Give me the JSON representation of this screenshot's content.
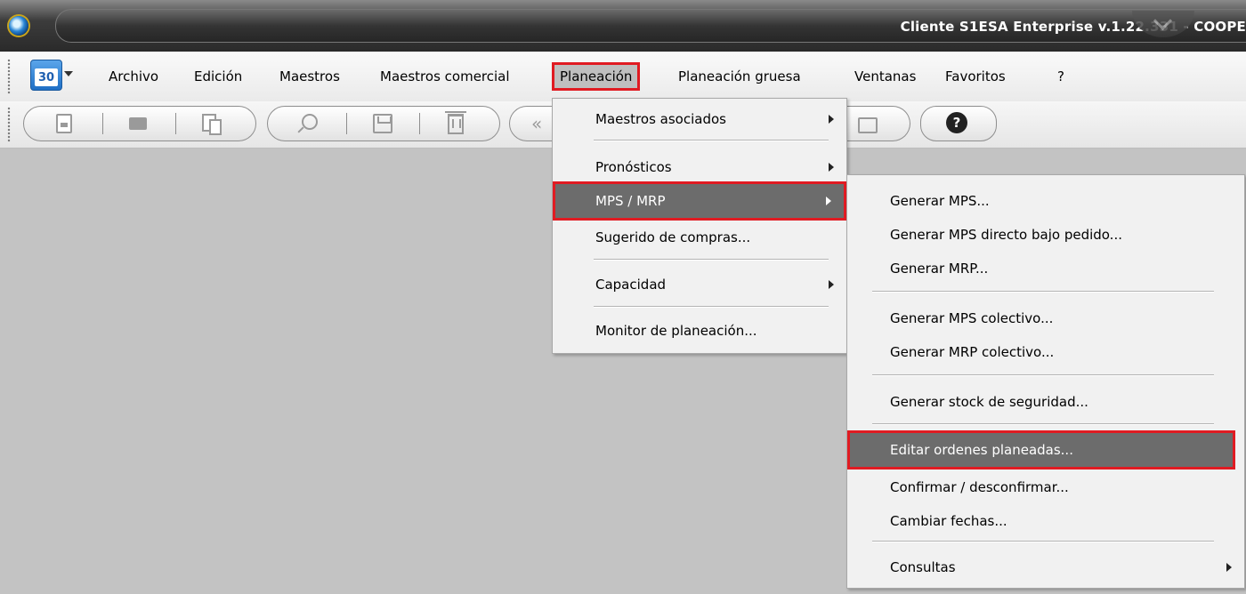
{
  "window": {
    "title": "Cliente S1ESA Enterprise v.1.22.331 - COOPE"
  },
  "menubar": {
    "calendar_icon_label": "30",
    "items": [
      {
        "label": "Archivo"
      },
      {
        "label": "Edición"
      },
      {
        "label": "Maestros"
      },
      {
        "label": "Maestros comercial"
      },
      {
        "label": "Planeación"
      },
      {
        "label": "Planeación gruesa"
      },
      {
        "label": "Ventanas"
      },
      {
        "label": "Favoritos"
      },
      {
        "label": "?"
      }
    ],
    "active": "Planeación"
  },
  "toolbar": {
    "icons": [
      "new-document-icon",
      "open-folder-icon",
      "copy-icon",
      "search-icon",
      "save-icon",
      "delete-icon",
      "back-icon",
      "print-icon",
      "help-icon"
    ],
    "help_symbol": "?"
  },
  "planeacion_menu": {
    "items": [
      {
        "label": "Maestros asociados",
        "submenu": true
      },
      {
        "label": "Pronósticos",
        "submenu": true
      },
      {
        "label": "MPS / MRP",
        "submenu": true,
        "highlighted": true
      },
      {
        "label": "Sugerido de compras...",
        "submenu": false
      },
      {
        "label": "Capacidad",
        "submenu": true
      },
      {
        "label": "Monitor de planeación...",
        "submenu": false
      }
    ]
  },
  "mps_mrp_submenu": {
    "items": [
      {
        "label": "Generar MPS..."
      },
      {
        "label": "Generar MPS directo bajo pedido..."
      },
      {
        "label": "Generar MRP..."
      },
      {
        "label": "Generar MPS colectivo..."
      },
      {
        "label": "Generar MRP colectivo..."
      },
      {
        "label": "Generar stock de seguridad..."
      },
      {
        "label": "Editar ordenes planeadas...",
        "highlighted": true
      },
      {
        "label": "Confirmar / desconfirmar..."
      },
      {
        "label": "Cambiar fechas..."
      },
      {
        "label": "Consultas",
        "submenu": true
      }
    ]
  },
  "colors": {
    "highlight_border": "#e01b22",
    "menu_highlight": "#6c6c6c",
    "workspace": "#c3c3c3"
  }
}
